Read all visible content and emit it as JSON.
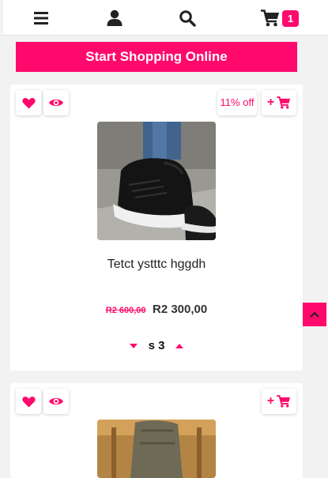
{
  "header": {
    "menu_icon": "menu-icon",
    "user_icon": "user-icon",
    "search_icon": "search-icon",
    "cart_icon": "cart-icon",
    "cart_count": "1"
  },
  "cta": {
    "label": "Start Shopping Online"
  },
  "products": [
    {
      "name": "Tetct ystttc hggdh",
      "discount": "11% off",
      "add_to_cart_label": "+",
      "old_price": "R2 600,00",
      "new_price": "R2 300,00",
      "size_label": "s",
      "quantity": "3"
    },
    {
      "add_to_cart_label": "+"
    }
  ],
  "colors": {
    "accent": "#ff0a6c",
    "background": "#f2f2f2",
    "card": "#ffffff"
  }
}
